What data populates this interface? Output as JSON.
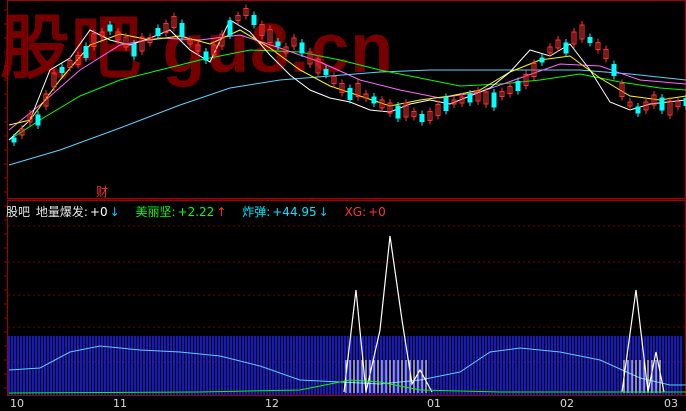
{
  "watermark": "股吧 gu8.cn",
  "event_marker": "财",
  "indicator": {
    "name": "股吧",
    "items": [
      {
        "label": "地量爆发:",
        "value": "+0",
        "arrow": "↓",
        "color": "#ffffff",
        "arrow_color": "#00ccff"
      },
      {
        "label": "美丽坚:",
        "value": "+2.22",
        "arrow": "↑",
        "color": "#00ff00",
        "arrow_color": "#ff3333"
      },
      {
        "label": "炸弹:",
        "value": "+44.95",
        "arrow": "↓",
        "color": "#00e5ff",
        "arrow_color": "#00ccff"
      },
      {
        "label": "XG:",
        "value": "+0",
        "arrow": "",
        "color": "#ff3333",
        "arrow_color": "#ff3333"
      }
    ]
  },
  "x_axis": [
    "10",
    "11",
    "12",
    "01",
    "02",
    "03"
  ],
  "colors": {
    "up": "#ff3333",
    "down": "#00ffff",
    "ma5": "#ffffff",
    "ma10": "#ffff00",
    "ma20": "#ff66ff",
    "ma30": "#00ff00",
    "ma60": "#5ad2ff",
    "bars": "#1e1ef0"
  }
}
